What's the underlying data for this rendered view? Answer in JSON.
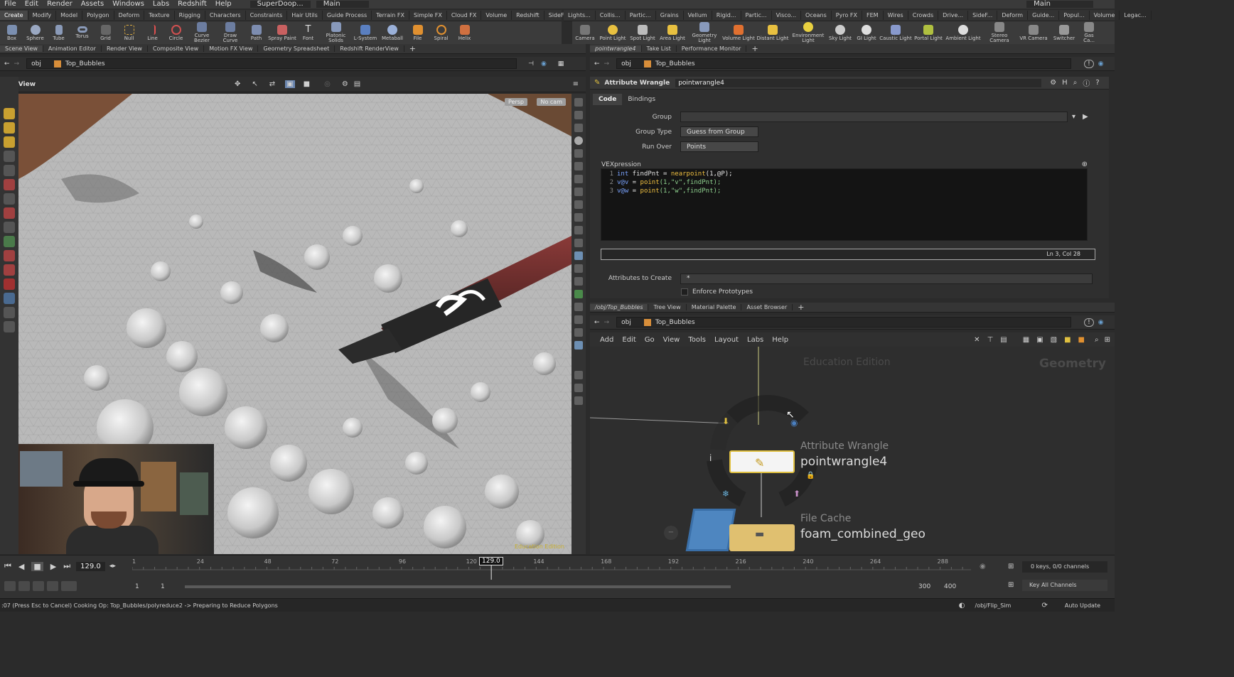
{
  "menubar": {
    "items": [
      "File",
      "Edit",
      "Render",
      "Assets",
      "Windows",
      "Labs",
      "Redshift",
      "Help"
    ],
    "desktop": "SuperDoop...",
    "main": "Main",
    "right_main": "Main"
  },
  "shelf_left": {
    "tabs": [
      "Create",
      "Modify",
      "Model",
      "Polygon",
      "Deform",
      "Texture",
      "Rigging",
      "Characters",
      "Constraints",
      "Hair Utils",
      "Guide Process",
      "Terrain FX",
      "Simple FX",
      "Cloud FX",
      "Volume",
      "Redshift",
      "SideFX Labs"
    ],
    "tools": [
      "Box",
      "Sphere",
      "Tube",
      "Torus",
      "Grid",
      "Null",
      "Line",
      "Circle",
      "Curve Bezier",
      "Draw Curve",
      "Path",
      "Spray Paint",
      "Font",
      "Platonic Solids",
      "L-System",
      "Metaball",
      "File",
      "Spiral",
      "Helix"
    ]
  },
  "shelf_right": {
    "tabs": [
      "Lights...",
      "Collis...",
      "Partic...",
      "Grains",
      "Vellum",
      "Rigid...",
      "Partic...",
      "Visco...",
      "Oceans",
      "Pyro FX",
      "FEM",
      "Wires",
      "Crowds",
      "Drive...",
      "SideF...",
      "Deform",
      "Guide...",
      "Popul...",
      "Volume",
      "Legac..."
    ],
    "tools": [
      "Camera",
      "Point Light",
      "Spot Light",
      "Area Light",
      "Geometry Light",
      "Volume Light",
      "Distant Light",
      "Environment Light",
      "Sky Light",
      "GI Light",
      "Caustic Light",
      "Portal Light",
      "Ambient Light",
      "Stereo Camera",
      "VR Camera",
      "Switcher",
      "Gas Ca..."
    ]
  },
  "left_pane": {
    "tabs": [
      "Scene View",
      "Animation Editor",
      "Render View",
      "Composite View",
      "Motion FX View",
      "Geometry Spreadsheet",
      "Redshift RenderView"
    ],
    "path_obj": "obj",
    "path_node": "Top_Bubbles",
    "view_label": "View",
    "persp": "Persp",
    "cam": "No cam",
    "watermark": "Education Edition"
  },
  "param_pane": {
    "tabs": [
      "pointwrangle4",
      "Take List",
      "Performance Monitor"
    ],
    "path_obj": "obj",
    "path_node": "Top_Bubbles",
    "node_type": "Attribute Wrangle",
    "node_name": "pointwrangle4",
    "subtabs": [
      "Code",
      "Bindings"
    ],
    "group_label": "Group",
    "group_value": "",
    "group_type_label": "Group Type",
    "group_type_value": "Guess from Group",
    "run_over_label": "Run Over",
    "run_over_value": "Points",
    "vex_label": "VEXpression",
    "code_lines": [
      {
        "n": "1",
        "kw": "int",
        "rest1": " findPnt = ",
        "fn": "nearpoint",
        "rest2": "(1,@P);"
      },
      {
        "n": "2",
        "kw": "v@v",
        "rest1": " = ",
        "fn": "point",
        "rest2": "(1,\"v\",findPnt);"
      },
      {
        "n": "3",
        "kw": "v@w",
        "rest1": " = ",
        "fn": "point",
        "rest2": "(1,\"w\",findPnt);"
      }
    ],
    "cursor_pos": "Ln 3, Col 28",
    "attr_create_label": "Attributes to Create",
    "attr_create_value": "*",
    "enforce_label": "Enforce Prototypes"
  },
  "network_pane": {
    "tabs": [
      "/obj/Top_Bubbles",
      "Tree View",
      "Material Palette",
      "Asset Browser"
    ],
    "path_obj": "obj",
    "path_node": "Top_Bubbles",
    "menu": [
      "Add",
      "Edit",
      "Go",
      "View",
      "Tools",
      "Layout",
      "Labs",
      "Help"
    ],
    "watermark": "Education Edition",
    "context": "Geometry",
    "node1_type": "Attribute Wrangle",
    "node1_name": "pointwrangle4",
    "node2_type": "File Cache",
    "node2_name": "foam_combined_geo"
  },
  "timeline": {
    "frame": "129.0",
    "current": "129.0",
    "ticks": [
      "1",
      "24",
      "48",
      "72",
      "96",
      "120",
      "144",
      "168",
      "192",
      "216",
      "240",
      "264",
      "288"
    ],
    "start1": "1",
    "start2": "1",
    "end1": "300",
    "end2": "400",
    "keys": "0 keys, 0/0 channels",
    "key_all": "Key All Channels"
  },
  "status": {
    "message": ":07 (Press Esc to Cancel) Cooking Op: Top_Bubbles/polyreduce2 -> Preparing to Reduce Polygons",
    "path": "/obj/Flip_Sim",
    "update": "Auto Update"
  }
}
